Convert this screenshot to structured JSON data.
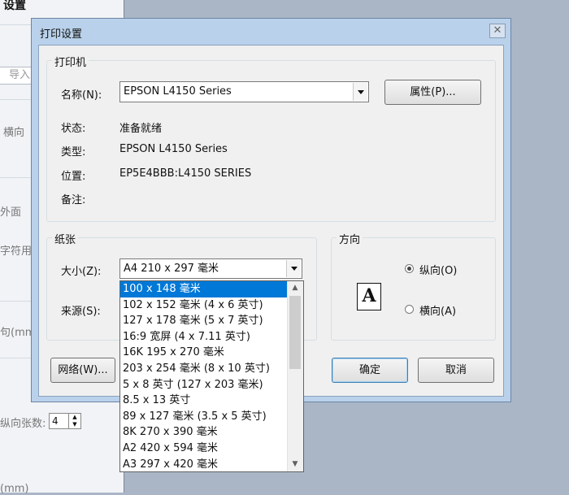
{
  "background_app": {
    "title": "设置",
    "input_placeholder": "导入",
    "texts": [
      "横向",
      "外面",
      "字符用",
      "句(mm)",
      "纵向张数:",
      "(mm)"
    ],
    "stepper_value": "4"
  },
  "dialog": {
    "title": "打印设置",
    "close_label": "✕",
    "printer_group": {
      "legend": "打印机",
      "name_label": "名称(N):",
      "name_value": "EPSON L4150 Series",
      "properties_button": "属性(P)...",
      "status_label": "状态:",
      "status_value": "准备就绪",
      "type_label": "类型:",
      "type_value": "EPSON L4150 Series",
      "location_label": "位置:",
      "location_value": "EP5E4BBB:L4150 SERIES",
      "comment_label": "备注:"
    },
    "paper_group": {
      "legend": "纸张",
      "size_label": "大小(Z):",
      "size_value": "A4 210 x 297 毫米",
      "source_label": "来源(S):"
    },
    "orientation_group": {
      "legend": "方向",
      "icon_letter": "A",
      "portrait_label": "纵向(O)",
      "landscape_label": "横向(A)",
      "selected": "portrait"
    },
    "buttons": {
      "network": "网络(W)...",
      "ok": "确定",
      "cancel": "取消"
    },
    "size_dropdown": {
      "selected_index": 0,
      "options": [
        "100 x 148 毫米",
        "102 x 152 毫米 (4 x 6 英寸)",
        "127 x 178 毫米 (5 x 7 英寸)",
        "16:9 宽屏 (4 x 7.11 英寸)",
        "16K 195 x 270 毫米",
        "203 x 254 毫米 (8 x 10 英寸)",
        "5 x 8 英寸 (127 x 203 毫米)",
        "8.5 x 13 英寸",
        "89 x 127 毫米 (3.5 x 5 英寸)",
        "8K 270 x 390 毫米",
        "A2 420 x 594 毫米",
        "A3 297 x 420 毫米"
      ]
    }
  },
  "colors": {
    "selection": "#0078d7",
    "dialog_frame": "#b9d1ea",
    "desktop": "#aab6c6"
  }
}
